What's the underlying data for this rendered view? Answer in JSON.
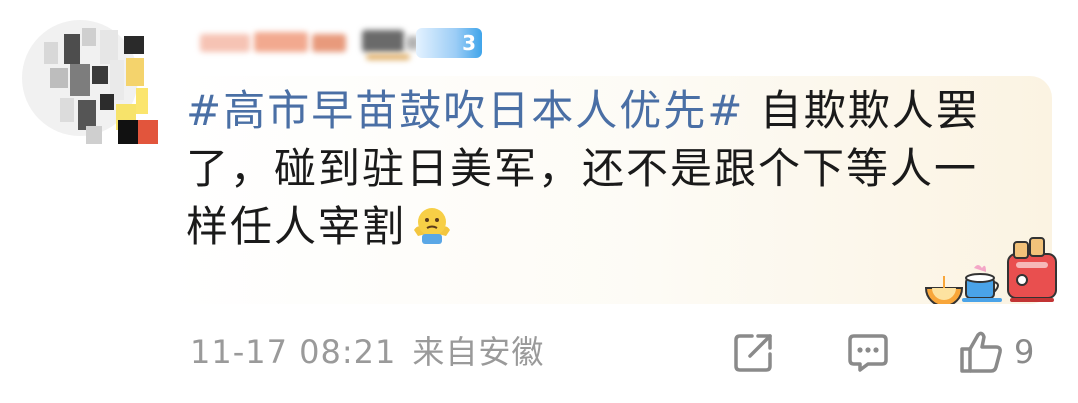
{
  "user": {
    "level_badge": "3"
  },
  "comment": {
    "hashtag": "#高市早苗鼓吹日本人优先#",
    "body": " 自欺欺人罢了，碰到驻日美军，还不是跟个下等人一样任人宰割",
    "emoji": "shrug-emoji"
  },
  "footer": {
    "timestamp": "11-17 08:21",
    "location": "来自安徽",
    "like_count": "9"
  },
  "colors": {
    "hashtag": "#4a6fa5",
    "text": "#1a1a1a",
    "meta": "#9a9a9a",
    "icon": "#8a8a8a"
  }
}
